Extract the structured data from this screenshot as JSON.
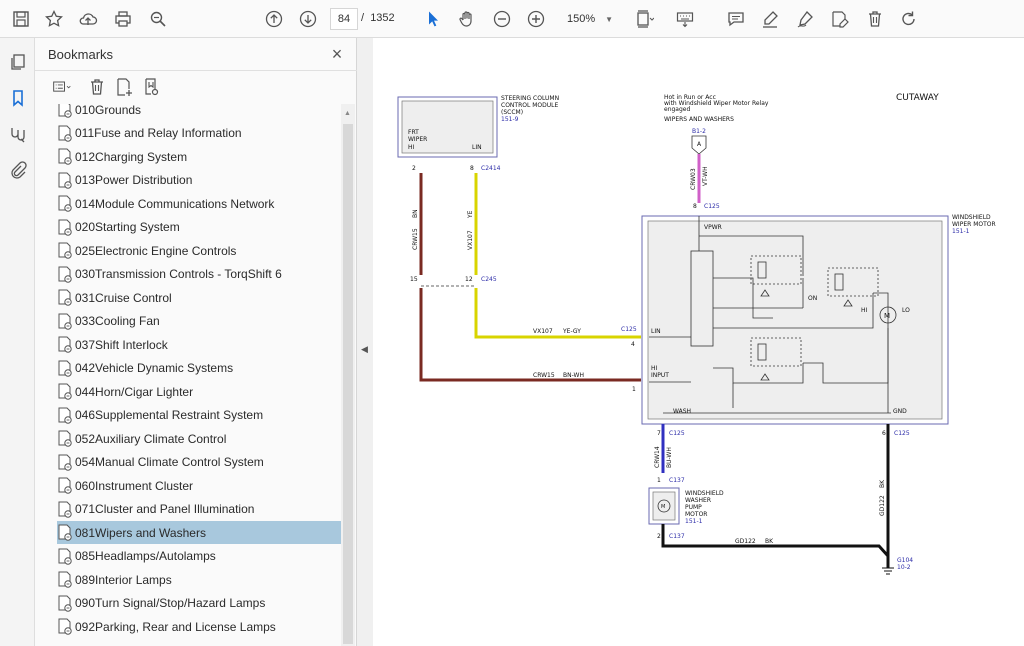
{
  "toolbar": {
    "page_current": "84",
    "page_separator": "/",
    "page_total": "1352",
    "zoom": "150%"
  },
  "panel": {
    "title": "Bookmarks",
    "close": "×"
  },
  "bookmarks": [
    {
      "label": "010Grounds",
      "selected": false
    },
    {
      "label": "011Fuse and Relay Information",
      "selected": false
    },
    {
      "label": "012Charging System",
      "selected": false
    },
    {
      "label": "013Power Distribution",
      "selected": false
    },
    {
      "label": "014Module Communications Network",
      "selected": false
    },
    {
      "label": "020Starting System",
      "selected": false
    },
    {
      "label": "025Electronic Engine Controls",
      "selected": false
    },
    {
      "label": "030Transmission Controls - TorqShift 6",
      "selected": false
    },
    {
      "label": "031Cruise Control",
      "selected": false
    },
    {
      "label": "033Cooling Fan",
      "selected": false
    },
    {
      "label": "037Shift Interlock",
      "selected": false
    },
    {
      "label": "042Vehicle Dynamic Systems",
      "selected": false
    },
    {
      "label": "044Horn/Cigar Lighter",
      "selected": false
    },
    {
      "label": "046Supplemental Restraint System",
      "selected": false
    },
    {
      "label": "052Auxiliary Climate Control",
      "selected": false
    },
    {
      "label": "054Manual Climate Control System",
      "selected": false
    },
    {
      "label": "060Instrument Cluster",
      "selected": false
    },
    {
      "label": "071Cluster and Panel Illumination",
      "selected": false
    },
    {
      "label": "081Wipers and Washers",
      "selected": true
    },
    {
      "label": "085Headlamps/Autolamps",
      "selected": false
    },
    {
      "label": "089Interior Lamps",
      "selected": false
    },
    {
      "label": "090Turn Signal/Stop/Hazard Lamps",
      "selected": false
    },
    {
      "label": "092Parking, Rear and License Lamps",
      "selected": false
    }
  ],
  "diagram": {
    "cutaway": "CUTAWAY",
    "sccm_title_1": "STEERING COLUMN",
    "sccm_title_2": "CONTROL MODULE",
    "sccm_title_3": "(SCCM)",
    "sccm_ref": "151-9",
    "sccm_int_1": "FRT",
    "sccm_int_2": "WIPER",
    "sccm_hi": "HI",
    "sccm_lin": "LIN",
    "hot_1": "Hot in Run or Acc",
    "hot_2": "with Windshield Wiper Motor Relay",
    "hot_3": "engaged",
    "hot_4": "WIPERS AND WASHERS",
    "fuse_ref": "B1-2",
    "fuse_letter": "A",
    "crw03": "CRW03",
    "vt_wh": "VT-WH",
    "pin_8_top": "8",
    "c125_top": "C125",
    "motor_title_1": "WINDSHIELD",
    "motor_title_2": "WIPER MOTOR",
    "motor_ref": "151-1",
    "vpwr": "VPWR",
    "on": "ON",
    "hi_sw": "HI",
    "lo_sw": "LO",
    "lin_in": "LIN",
    "hi_input_1": "HI",
    "hi_input_2": "INPUT",
    "wash": "WASH",
    "gnd": "GND",
    "pin_2": "2",
    "pin_8": "8",
    "c2414": "C2414",
    "bn": "BN",
    "ye": "YE",
    "crw15_v": "CRW15",
    "vx107_v": "VX107",
    "pin_15": "15",
    "pin_12": "12",
    "c245": "C245",
    "vx107_h": "VX107",
    "ye_gy": "YE-GY",
    "c125_lin": "C125",
    "pin_4": "4",
    "crw15_h": "CRW15",
    "bn_wh": "BN-WH",
    "pin_1": "1",
    "pin_7": "7",
    "c125_wash": "C125",
    "pin_6": "6",
    "c125_gnd": "C125",
    "crw14": "CRW14",
    "bu_wh": "BU-WH",
    "pin_1b": "1",
    "c137_a": "C137",
    "pump_1": "WINDSHIELD",
    "pump_2": "WASHER",
    "pump_3": "PUMP",
    "pump_4": "MOTOR",
    "pump_ref": "151-1",
    "pin_2b": "2",
    "c137_b": "C137",
    "gd122_h": "GD122",
    "bk_h": "BK",
    "gd122_v": "GD122",
    "bk_v": "BK",
    "g104": "G104",
    "g104_ref": "10-2"
  },
  "colors": {
    "wire_brown": "#7a2a22",
    "wire_yellow": "#d8d400",
    "wire_violet": "#d060c8",
    "wire_blue": "#3030c0",
    "wire_black": "#111111",
    "selection": "#a8c8dd",
    "bookmark_accent": "#1a6fd6"
  }
}
